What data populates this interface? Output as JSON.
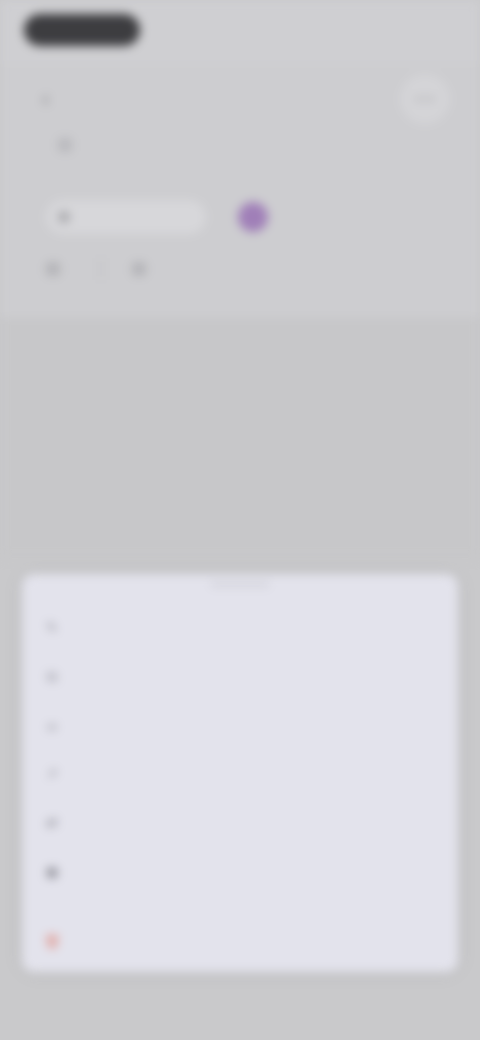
{
  "status_bar": {
    "time": "",
    "icons": ""
  },
  "header": {
    "title": "",
    "chip_a": "",
    "chip_b": "",
    "meta_a": "",
    "meta_b": ""
  },
  "sheet": {
    "items": [
      {
        "label": "",
        "icon": "pencil-icon"
      },
      {
        "label": "",
        "icon": "copy-icon"
      },
      {
        "label": "",
        "icon": "link-icon"
      },
      {
        "label": "",
        "icon": "share-icon"
      },
      {
        "label": "",
        "icon": "move-icon"
      },
      {
        "label": "",
        "icon": "archive-icon"
      }
    ],
    "danger_label": "",
    "danger_color": "#e07b6c"
  },
  "colors": {
    "accent_avatar": "#a07fb8",
    "sheet_background": "#e3e3ec"
  }
}
